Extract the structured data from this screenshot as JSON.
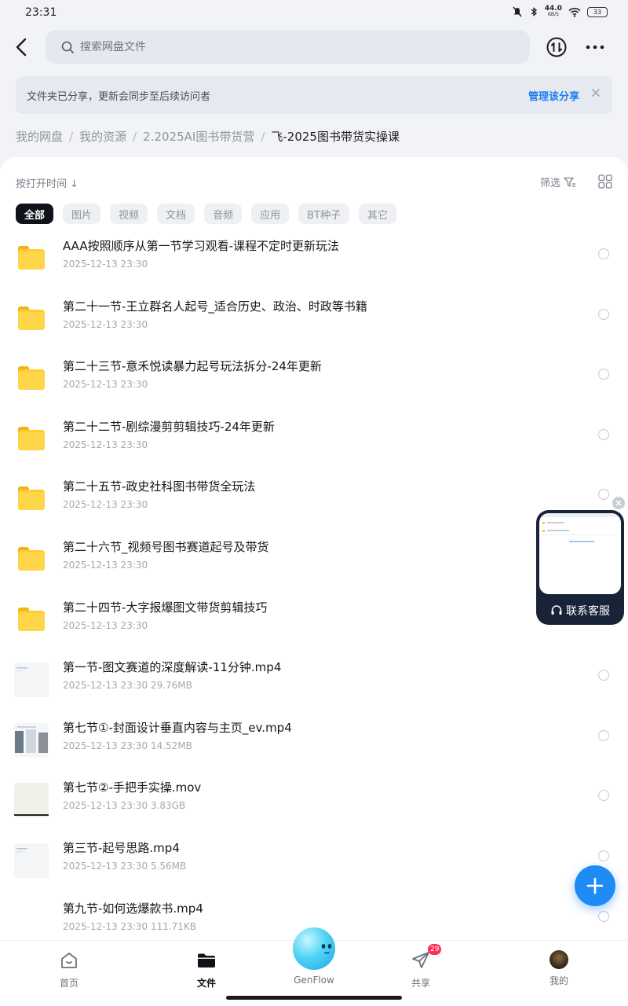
{
  "status_bar": {
    "time": "23:31",
    "net_speed_value": "44.0",
    "net_speed_unit": "KB/S",
    "battery": "33"
  },
  "search": {
    "placeholder": "搜索网盘文件"
  },
  "share_banner": {
    "text": "文件夹已分享，更新会同步至后续访问者",
    "action": "管理该分享"
  },
  "breadcrumb": [
    "我的网盘",
    "我的资源",
    "2.2025AI图书带货营",
    "飞-2025图书带货实操课"
  ],
  "toolbar": {
    "sort_label": "按打开时间 ↓",
    "filter_label": "筛选"
  },
  "chips": [
    "全部",
    "图片",
    "视频",
    "文档",
    "音频",
    "应用",
    "BT种子",
    "其它"
  ],
  "files": [
    {
      "name": "AAA按照顺序从第一节学习观看-课程不定时更新玩法",
      "meta": "2025-12-13  23:30",
      "type": "folder"
    },
    {
      "name": "第二十一节-王立群名人起号_适合历史、政治、时政等书籍",
      "meta": "2025-12-13  23:30",
      "type": "folder"
    },
    {
      "name": "第二十三节-意禾悦读暴力起号玩法拆分-24年更新",
      "meta": "2025-12-13  23:30",
      "type": "folder"
    },
    {
      "name": "第二十二节-剧综漫剪剪辑技巧-24年更新",
      "meta": "2025-12-13  23:30",
      "type": "folder"
    },
    {
      "name": "第二十五节-政史社科图书带货全玩法",
      "meta": "2025-12-13  23:30",
      "type": "folder"
    },
    {
      "name": "第二十六节_视频号图书赛道起号及带货",
      "meta": "2025-12-13  23:30",
      "type": "folder"
    },
    {
      "name": "第二十四节-大字报爆图文带货剪辑技巧",
      "meta": "2025-12-13  23:30",
      "type": "folder"
    },
    {
      "name": "第一节-图文赛道的深度解读-11分钟.mp4",
      "meta": "2025-12-13  23:30  29.76MB",
      "type": "video-light"
    },
    {
      "name": "第七节①-封面设计垂直内容与主页_ev.mp4",
      "meta": "2025-12-13  23:30  14.52MB",
      "type": "video-books"
    },
    {
      "name": "第七节②-手把手实操.mov",
      "meta": "2025-12-13  23:30  3.83GB",
      "type": "video-paper"
    },
    {
      "name": "第三节-起号思路.mp4",
      "meta": "2025-12-13  23:30  5.56MB",
      "type": "video-light"
    },
    {
      "name": "第九节-如何选爆款书.mp4",
      "meta": "2025-12-13  23:30  111.71KB",
      "type": "video-blank"
    }
  ],
  "float_card": {
    "label": "联系客服"
  },
  "bottom_nav": {
    "home": "首页",
    "files": "文件",
    "genflow": "GenFlow",
    "share": "共享",
    "share_badge": "29",
    "mine": "我的"
  },
  "colors": {
    "accent": "#1c7ff0",
    "folder": "#ffcd2b",
    "fab": "#1f8cf5",
    "badge": "#ff2d55"
  },
  "icons": [
    "back-arrow-icon",
    "search-icon",
    "sort-toggle-icon",
    "more-icon",
    "close-icon",
    "filter-icon",
    "grid-view-icon",
    "folder-icon",
    "video-thumbnail",
    "headset-icon",
    "plus-icon",
    "home-icon",
    "files-icon",
    "send-icon"
  ]
}
